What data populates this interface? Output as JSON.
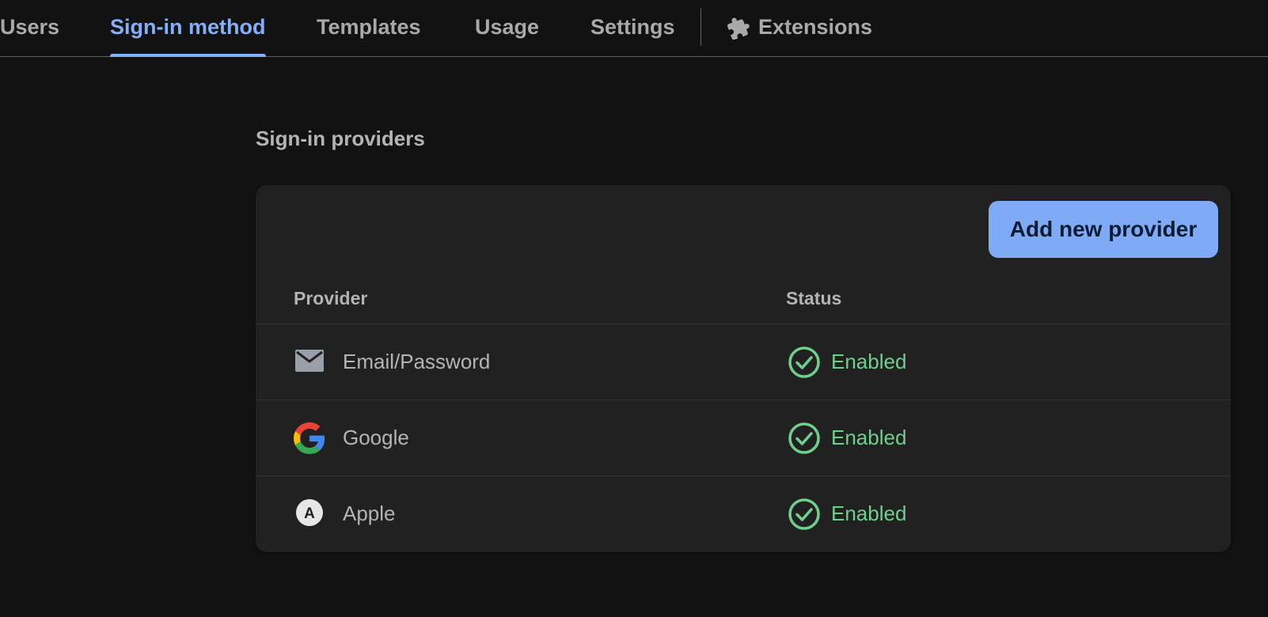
{
  "tabs": [
    {
      "label": "Users"
    },
    {
      "label": "Sign-in method",
      "active": true
    },
    {
      "label": "Templates"
    },
    {
      "label": "Usage"
    },
    {
      "label": "Settings"
    },
    {
      "label": "Extensions",
      "icon": "puzzle-piece-icon"
    }
  ],
  "section": {
    "title": "Sign-in providers"
  },
  "card": {
    "add_button_label": "Add new provider",
    "columns": {
      "provider": "Provider",
      "status": "Status"
    },
    "rows": [
      {
        "provider": "Email/Password",
        "icon": "envelope-icon",
        "status": "Enabled",
        "status_icon": "check-circle-icon"
      },
      {
        "provider": "Google",
        "icon": "google-logo-icon",
        "status": "Enabled",
        "status_icon": "check-circle-icon"
      },
      {
        "provider": "Apple",
        "icon": "apple-badge-icon",
        "icon_letter": "A",
        "status": "Enabled",
        "status_icon": "check-circle-icon"
      }
    ]
  },
  "colors": {
    "accent": "#83b0fb",
    "button": "#7eaaf6",
    "enabled": "#6fd08e",
    "background": "#121212",
    "card": "#212121"
  }
}
